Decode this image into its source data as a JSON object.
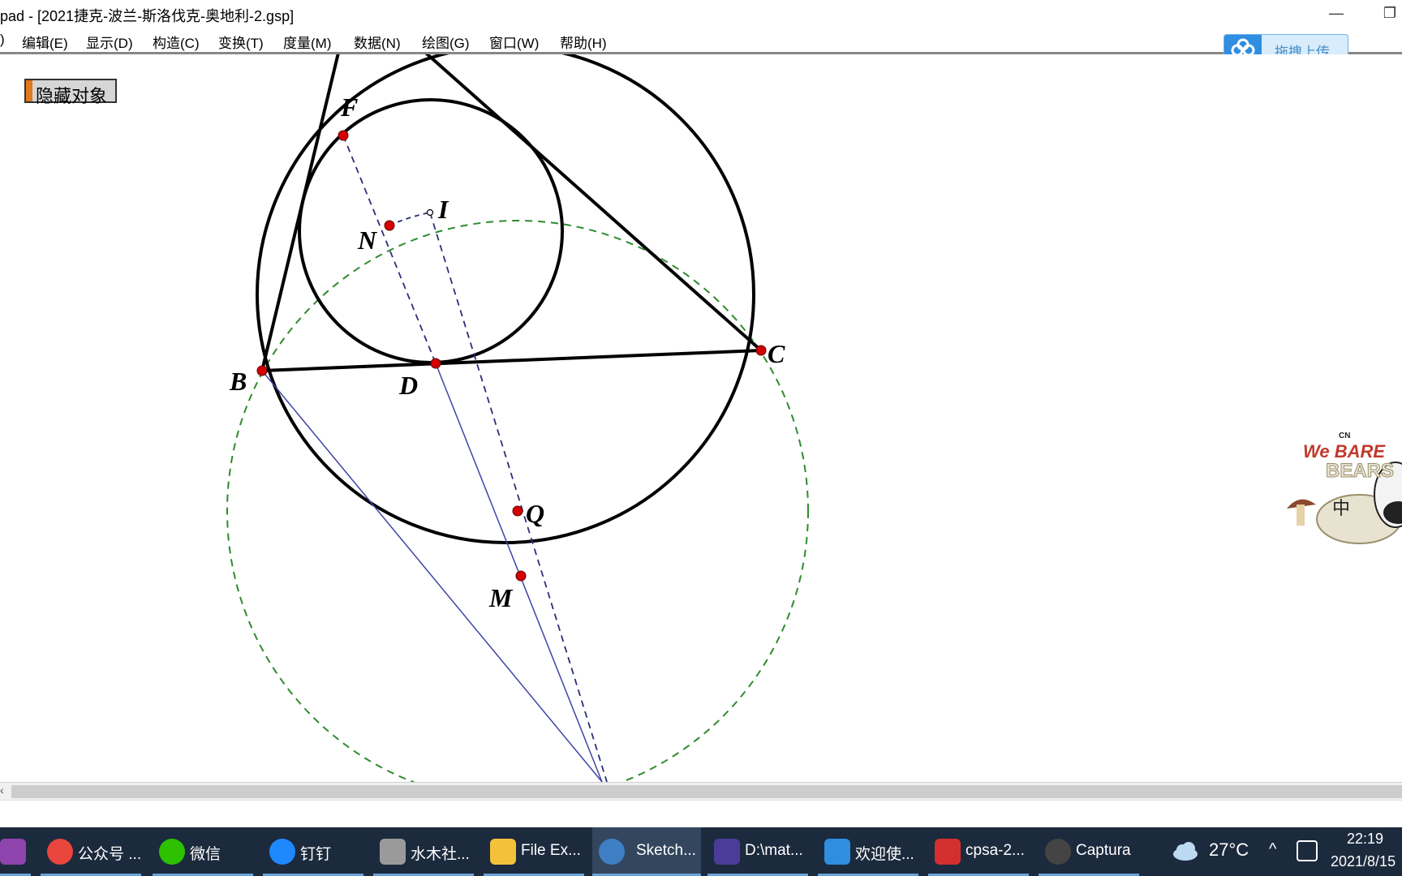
{
  "window": {
    "title": "pad  - [2021捷克-波兰-斯洛伐克-奥地利-2.gsp]",
    "minimize_glyph": "—",
    "restore_glyph": "❐"
  },
  "menu": {
    "items": [
      ")",
      "编辑(E)",
      "显示(D)",
      "构造(C)",
      "变换(T)",
      "度量(M)",
      "数据(N)",
      "绘图(G)",
      "窗口(W)",
      "帮助(H)"
    ]
  },
  "canvas": {
    "hide_button_label": "隐藏对象",
    "labels": {
      "F": "F",
      "I": "I",
      "N": "N",
      "B": "B",
      "D": "D",
      "C": "C",
      "Q": "Q",
      "M": "M"
    },
    "colors": {
      "main": "#000000",
      "point": "#d40000",
      "dash_blue": "#2b2f7a",
      "blue_line": "#3f44a8",
      "dash_green": "#2e8b2e"
    }
  },
  "cloud_widget": {
    "label": "拖拽上传",
    "icon": "baidu-cloud-icon"
  },
  "sticker": {
    "line1": "We BARE",
    "line2": "BEARS",
    "badge": "CN",
    "ime_char": "中"
  },
  "taskbar": {
    "items": [
      {
        "icon": "onenote-icon",
        "label": "",
        "color": "#8e44ad"
      },
      {
        "icon": "chrome-icon",
        "label": "公众号 ...",
        "color": "#e8453c"
      },
      {
        "icon": "wechat-icon",
        "label": "微信",
        "color": "#2dc100"
      },
      {
        "icon": "dingtalk-icon",
        "label": "钉钉",
        "color": "#1e88ff"
      },
      {
        "icon": "shuimu-icon",
        "label": "水木社...",
        "color": "#9a9a9a"
      },
      {
        "icon": "folder-icon",
        "label": "File Ex...",
        "color": "#f3c13a"
      },
      {
        "icon": "sketchpad-icon",
        "label": "Sketch...",
        "color": "#3f7fc4"
      },
      {
        "icon": "tex-icon",
        "label": "D:\\mat...",
        "color": "#4b3c9a"
      },
      {
        "icon": "baidu-netdisk-icon",
        "label": "欢迎使...",
        "color": "#2f8ee0"
      },
      {
        "icon": "pdf-icon",
        "label": "cpsa-2...",
        "color": "#d32f2f"
      },
      {
        "icon": "captura-icon",
        "label": "Captura",
        "color": "#444444"
      }
    ],
    "weather": {
      "icon": "cloud-icon",
      "temp": "27°C"
    },
    "tray_chevron": "^",
    "clock": {
      "time": "22:19",
      "date": "2021/8/15"
    }
  }
}
